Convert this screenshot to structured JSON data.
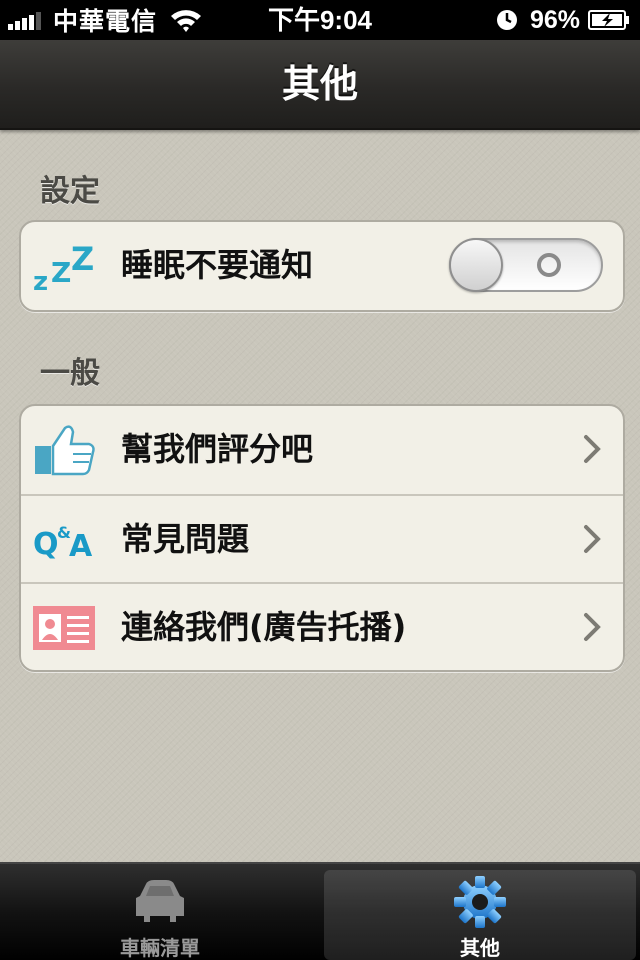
{
  "status_bar": {
    "carrier": "中華電信",
    "time": "下午9:04",
    "battery": "96%"
  },
  "nav": {
    "title": "其他"
  },
  "sections": {
    "settings": {
      "header": "設定",
      "sleep_label": "睡眠不要通知",
      "sleep_toggle": "off"
    },
    "general": {
      "header": "一般",
      "items": [
        {
          "label": "幫我們評分吧",
          "icon": "thumbs-up-icon"
        },
        {
          "label": "常見問題",
          "icon": "qa-icon"
        },
        {
          "label": "連絡我們(廣告托播)",
          "icon": "contact-card-icon"
        }
      ]
    }
  },
  "tabs": [
    {
      "label": "車輛清單",
      "icon": "car-icon",
      "selected": false
    },
    {
      "label": "其他",
      "icon": "gear-icon",
      "selected": true
    }
  ],
  "colors": {
    "accent_blue": "#2a8fd8",
    "zzz_blue": "#2aa7c7",
    "card_pink": "#f08a92"
  }
}
